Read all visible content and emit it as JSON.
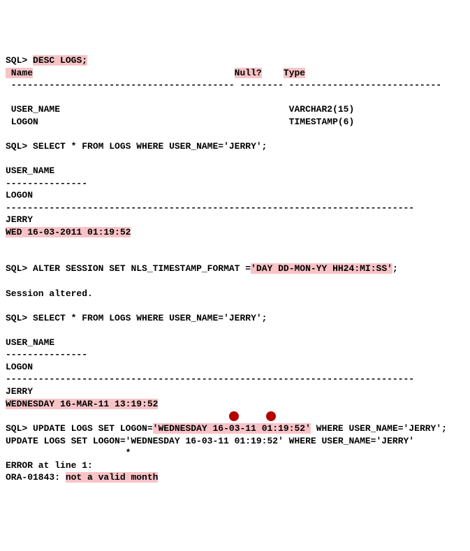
{
  "prompt": "SQL>",
  "cmd1": "DESC LOGS;",
  "desc_header": {
    "name": " Name",
    "null": "Null?",
    "type": "Type"
  },
  "desc_rule_left": " -----------------------------------------",
  "desc_rule_mid": " --------",
  "desc_rule_right": " ----------------------------",
  "desc_rows": [
    {
      "name": " USER_NAME",
      "type": "VARCHAR2(15)"
    },
    {
      "name": " LOGON",
      "type": "TIMESTAMP(6)"
    }
  ],
  "cmd2": "SELECT * FROM LOGS WHERE USER_NAME='JERRY';",
  "col_user": "USER_NAME",
  "rule_short": "---------------",
  "col_logon": "LOGON",
  "rule_long": "---------------------------------------------------------------------------",
  "result1_user": "JERRY",
  "result1_logon": "WED 16-03-2011 01:19:52",
  "cmd3_pre": "ALTER SESSION SET NLS_TIMESTAMP_FORMAT =",
  "cmd3_hl": "'DAY DD-MON-YY HH24:MI:SS'",
  "cmd3_post": ";",
  "session_altered": "Session altered.",
  "cmd4": "SELECT * FROM LOGS WHERE USER_NAME='JERRY';",
  "result2_user": "JERRY",
  "result2_logon": "WEDNESDAY 16-MAR-11 13:19:52",
  "cmd5_pre": "UPDATE LOGS SET LOGON=",
  "cmd5_hl": "'WEDNESDAY 16-03-11 01:19:52'",
  "cmd5_post": " WHERE USER_NAME='JERRY';",
  "echo5": "UPDATE LOGS SET LOGON='WEDNESDAY 16-03-11 01:19:52' WHERE USER_NAME='JERRY'",
  "caret_line": "                      *",
  "err_line": "ERROR at line 1:",
  "err_code": "ORA-01843: ",
  "err_msg": "not a valid month"
}
